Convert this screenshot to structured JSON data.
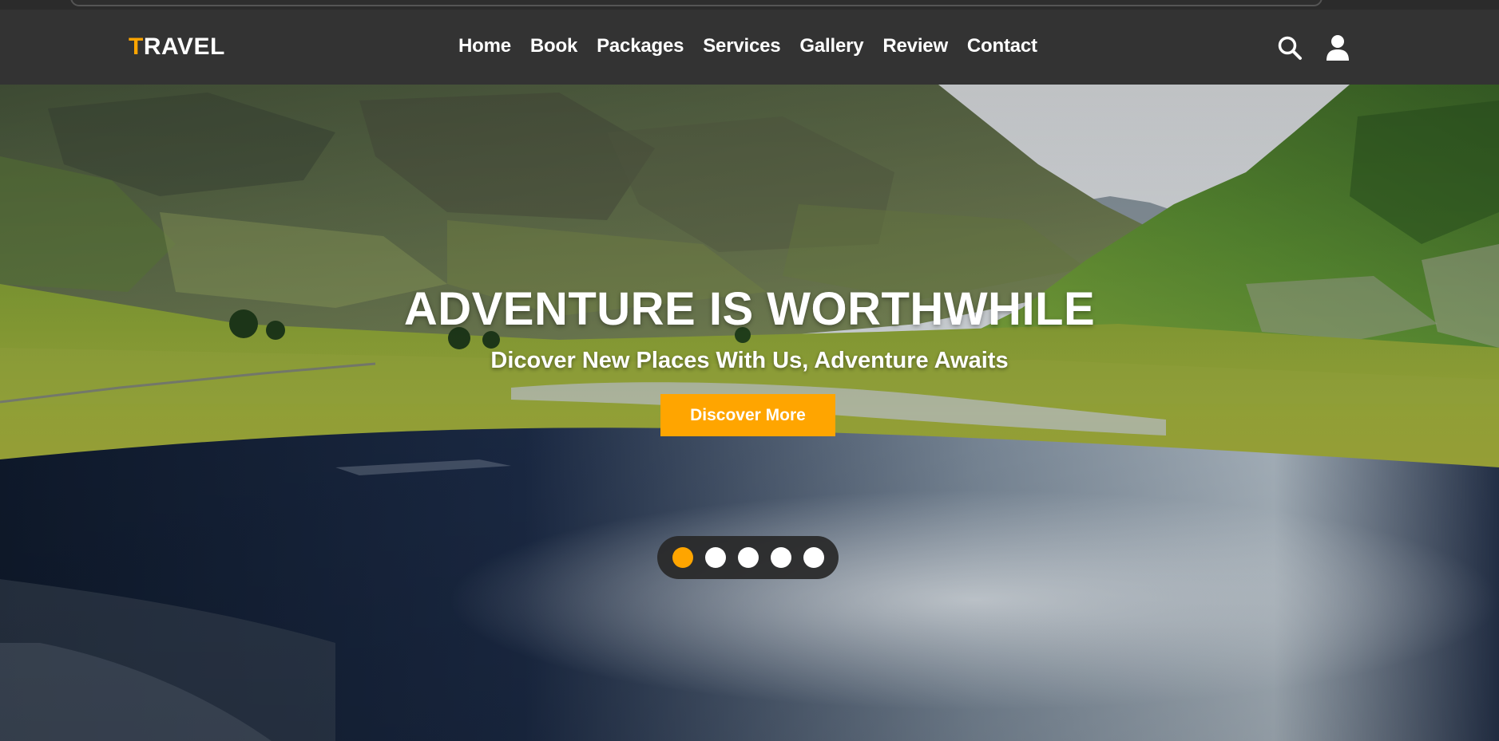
{
  "brand": {
    "first_letter": "T",
    "rest": "RAVEL",
    "accent_color": "#ffa500"
  },
  "nav": {
    "items": [
      {
        "label": "Home"
      },
      {
        "label": "Book"
      },
      {
        "label": "Packages"
      },
      {
        "label": "Services"
      },
      {
        "label": "Gallery"
      },
      {
        "label": "Review"
      },
      {
        "label": "Contact"
      }
    ]
  },
  "header_icons": [
    "search-icon",
    "user-icon"
  ],
  "hero": {
    "title": "ADVENTURE IS WORTHWHILE",
    "subtitle": "Dicover New Places With Us, Adventure Awaits",
    "cta_label": "Discover More",
    "slides": {
      "count": 5,
      "active_index": 0
    }
  },
  "colors": {
    "header_bg": "#333333",
    "accent": "#ffa500",
    "text": "#ffffff"
  }
}
